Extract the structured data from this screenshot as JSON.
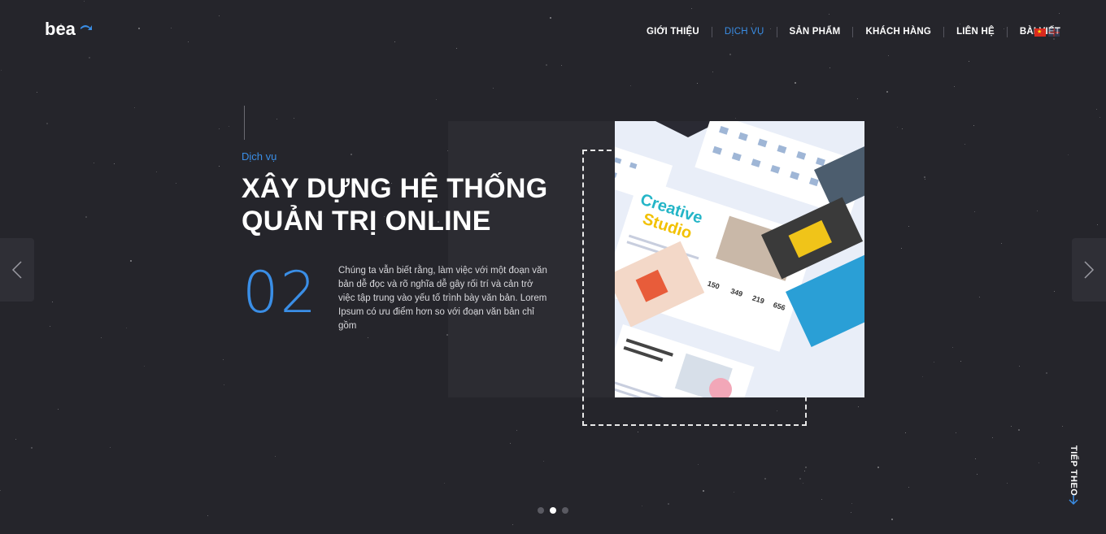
{
  "header": {
    "logo_text": "bea",
    "nav": [
      {
        "label": "GIỚI THIỆU",
        "active": false
      },
      {
        "label": "DỊCH VỤ",
        "active": true
      },
      {
        "label": "SẢN PHẨM",
        "active": false
      },
      {
        "label": "KHÁCH HÀNG",
        "active": false
      },
      {
        "label": "LIÊN HỆ",
        "active": false
      },
      {
        "label": "BÀI VIẾT",
        "active": false
      }
    ],
    "languages": [
      "vi-flag-icon",
      "en-flag-icon"
    ]
  },
  "hero": {
    "subtitle": "Dịch vụ",
    "title_line1": "XÂY DỰNG HỆ THỐNG",
    "title_line2": "QUẢN TRỊ ONLINE",
    "number": "02",
    "description": "Chúng ta vẫn biết rằng, làm việc với một đoạn văn bản dễ đọc và rõ nghĩa dễ gây rối trí và cản trở việc tập trung vào yếu tố trình bày văn bản. Lorem Ipsum có ưu điểm hơn so với đoạn văn bản chỉ gồm",
    "mockup": {
      "headline": "Creative Studio",
      "stats": [
        "150",
        "349",
        "219",
        "656"
      ]
    }
  },
  "pagination": {
    "count": 3,
    "active_index": 1
  },
  "next_label": "TIẾP THEO",
  "colors": {
    "background": "#25252b",
    "accent": "#3a8ee6",
    "panel": "#2c2c32"
  }
}
